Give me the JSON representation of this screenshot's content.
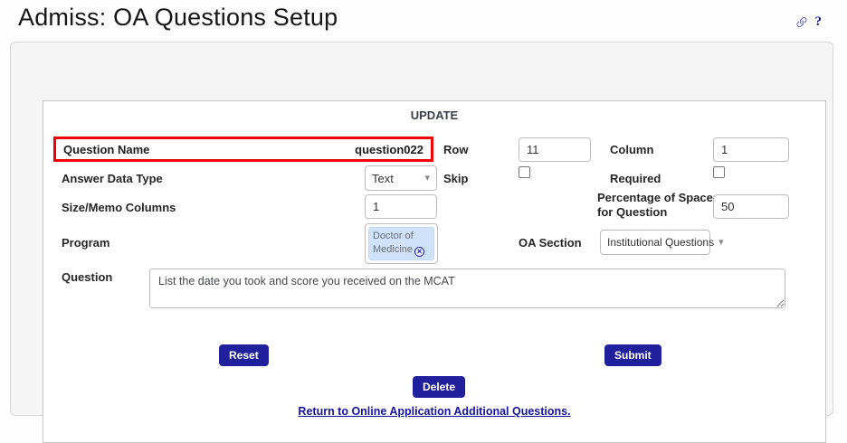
{
  "page": {
    "title": "Admiss: OA Questions Setup"
  },
  "icons": {
    "help": "?",
    "caret_down": "▾",
    "remove_x": "×"
  },
  "panel": {
    "heading": "UPDATE"
  },
  "fields": {
    "question_name": {
      "label": "Question Name",
      "value": "question022"
    },
    "row": {
      "label": "Row",
      "value": "11"
    },
    "column": {
      "label": "Column",
      "value": "1"
    },
    "answer_data_type": {
      "label": "Answer Data Type",
      "value": "Text"
    },
    "skip": {
      "label": "Skip",
      "checked": false
    },
    "required": {
      "label": "Required",
      "checked": false
    },
    "size_memo_columns": {
      "label": "Size/Memo Columns",
      "value": "1"
    },
    "percentage_space": {
      "label": "Percentage of Space for Question",
      "value": "50"
    },
    "program": {
      "label": "Program",
      "selected_chip": "Doctor of Medicine"
    },
    "oa_section": {
      "label": "OA Section",
      "value": "Institutional Questions"
    },
    "question": {
      "label": "Question",
      "value": "List the date you took and score you received on the MCAT"
    }
  },
  "buttons": {
    "reset": "Reset",
    "submit": "Submit",
    "delete": "Delete"
  },
  "links": {
    "return": "Return to Online Application Additional Questions."
  },
  "colors": {
    "accent_navy": "#20209c",
    "highlight_red": "#f10000",
    "chip_bg": "#cfe2fa",
    "link_navy": "#1414a0"
  }
}
